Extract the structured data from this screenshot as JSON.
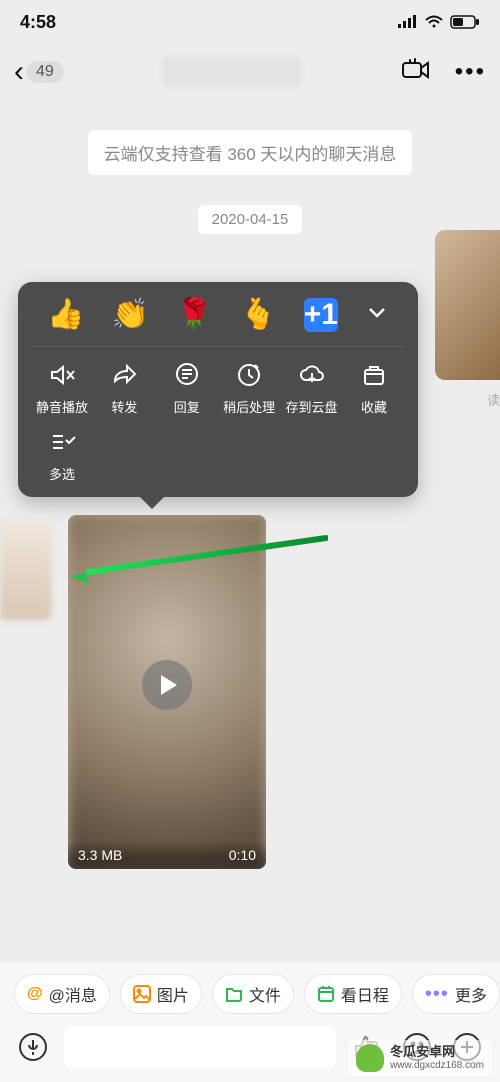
{
  "status": {
    "time": "4:58"
  },
  "nav": {
    "back_count": "49"
  },
  "chat": {
    "notice": "云端仅支持查看 360 天以内的聊天消息",
    "date": "2020-04-15",
    "read": "读",
    "video": {
      "size": "3.3 MB",
      "duration": "0:10"
    }
  },
  "ctx": {
    "reactions": {
      "plus1": "+1"
    },
    "items": {
      "mute": "静音播放",
      "forward": "转发",
      "reply": "回复",
      "later": "稍后处理",
      "cloud": "存到云盘",
      "fav": "收藏",
      "multi": "多选"
    }
  },
  "chips": {
    "mention": "@消息",
    "image": "图片",
    "file": "文件",
    "calendar": "看日程",
    "more": "更多"
  },
  "watermark": {
    "line1": "冬瓜安卓网",
    "line2": "www.dgxcdz168.com"
  }
}
